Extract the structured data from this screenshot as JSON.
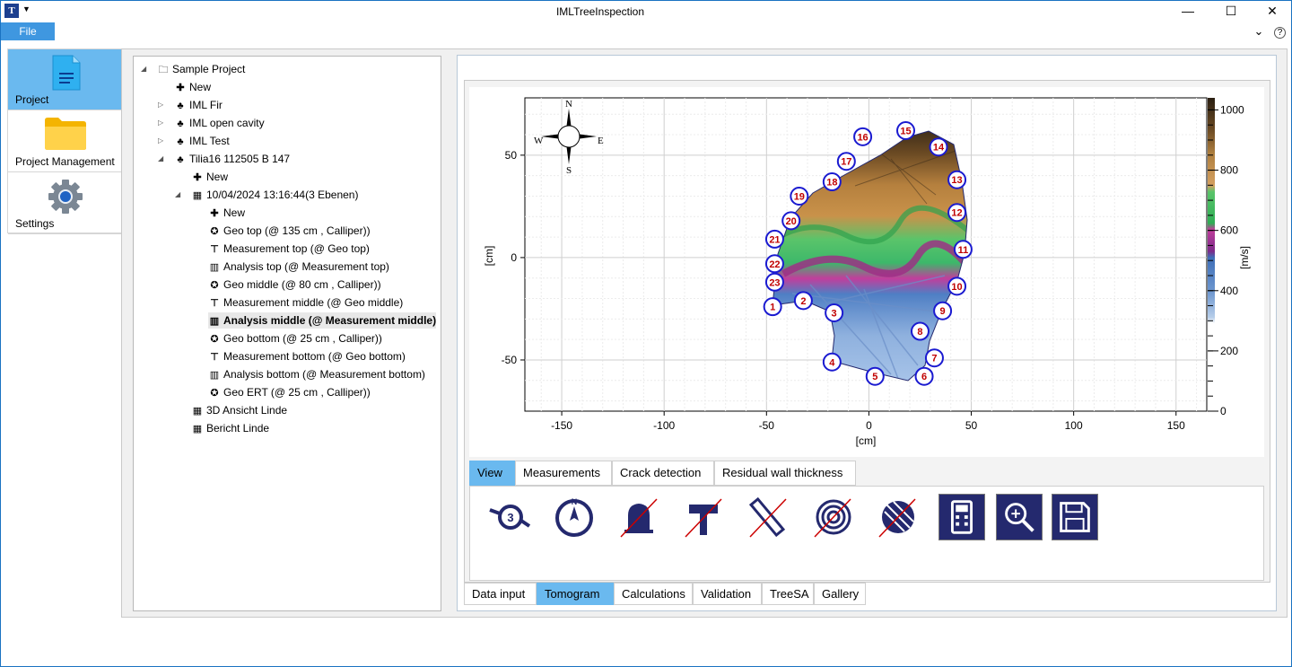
{
  "window": {
    "title": "IMLTreeInspection",
    "minimize": "—",
    "maximize": "☐",
    "close": "✕"
  },
  "menu": {
    "file": "File",
    "collapse": "⌄",
    "help": "?"
  },
  "nav": [
    {
      "label": "Project",
      "icon": "document-icon"
    },
    {
      "label": "Project Management",
      "icon": "folder-icon"
    },
    {
      "label": "Settings",
      "icon": "gear-icon"
    }
  ],
  "tree": {
    "root": "Sample Project",
    "items": [
      "New",
      "IML Fir",
      "IML open cavity",
      "IML Test",
      "Tilia16 112505 B 147",
      "New",
      "10/04/2024 13:16:44(3 Ebenen)",
      "New",
      "Geo top (@ 135 cm , Calliper))",
      "Measurement top (@ Geo top)",
      "Analysis top (@ Measurement top)",
      "Geo middle (@ 80 cm , Calliper))",
      "Measurement middle (@ Geo middle)",
      "Analysis middle (@ Measurement middle)",
      "Geo bottom (@ 25 cm , Calliper))",
      "Measurement bottom (@ Geo bottom)",
      "Analysis bottom (@ Measurement bottom)",
      "Geo ERT (@ 25 cm , Calliper))",
      "3D Ansicht Linde",
      "Bericht Linde"
    ]
  },
  "compass": {
    "n": "N",
    "s": "S",
    "e": "E",
    "w": "W"
  },
  "chart_data": {
    "type": "heatmap",
    "xlabel": "[cm]",
    "ylabel": "[cm]",
    "colorbar_label": "[m/s]",
    "x_ticks": [
      "-150",
      "-100",
      "-50",
      "0",
      "50",
      "100",
      "150"
    ],
    "y_ticks": [
      "50",
      "0",
      "-50"
    ],
    "colorbar_ticks": [
      "1000",
      "800",
      "600",
      "400",
      "200",
      "0"
    ],
    "xlim": [
      -168,
      165
    ],
    "ylim": [
      -75,
      78
    ],
    "colorbar_range": [
      0,
      1040
    ],
    "grid": true,
    "sensors": [
      {
        "label": "1",
        "x": -47,
        "y": -24
      },
      {
        "label": "2",
        "x": -32,
        "y": -21
      },
      {
        "label": "3",
        "x": -17,
        "y": -27
      },
      {
        "label": "4",
        "x": -18,
        "y": -51
      },
      {
        "label": "5",
        "x": 3,
        "y": -58
      },
      {
        "label": "6",
        "x": 27,
        "y": -58
      },
      {
        "label": "7",
        "x": 32,
        "y": -49
      },
      {
        "label": "8",
        "x": 25,
        "y": -36
      },
      {
        "label": "9",
        "x": 36,
        "y": -26
      },
      {
        "label": "10",
        "x": 43,
        "y": -14
      },
      {
        "label": "11",
        "x": 46,
        "y": 4
      },
      {
        "label": "12",
        "x": 43,
        "y": 22
      },
      {
        "label": "13",
        "x": 43,
        "y": 38
      },
      {
        "label": "14",
        "x": 34,
        "y": 54
      },
      {
        "label": "15",
        "x": 18,
        "y": 62
      },
      {
        "label": "16",
        "x": -3,
        "y": 59
      },
      {
        "label": "17",
        "x": -11,
        "y": 47
      },
      {
        "label": "18",
        "x": -18,
        "y": 37
      },
      {
        "label": "19",
        "x": -34,
        "y": 30
      },
      {
        "label": "20",
        "x": -38,
        "y": 18
      },
      {
        "label": "21",
        "x": -46,
        "y": 9
      },
      {
        "label": "22",
        "x": -46,
        "y": -3
      },
      {
        "label": "23",
        "x": -46,
        "y": -12
      }
    ]
  },
  "view_tabs": [
    "View",
    "Measurements",
    "Crack detection",
    "Residual wall thickness"
  ],
  "tools": [
    "sensor-number-icon",
    "compass-icon",
    "bell-off-icon",
    "hammer-off-icon",
    "ruler-off-icon",
    "rings-off-icon",
    "hatch-off-icon",
    "calculator-icon",
    "zoom-icon",
    "save-icon"
  ],
  "bottom_tabs": [
    "Data input",
    "Tomogram",
    "Calculations",
    "Validation",
    "TreeSA",
    "Gallery"
  ],
  "colors": {
    "accent": "#6ab9ef",
    "file_menu": "#3f97e0",
    "sensor_ring": "#1a1ad0",
    "sensor_text": "#c00000",
    "tool_navy": "#24296e"
  }
}
